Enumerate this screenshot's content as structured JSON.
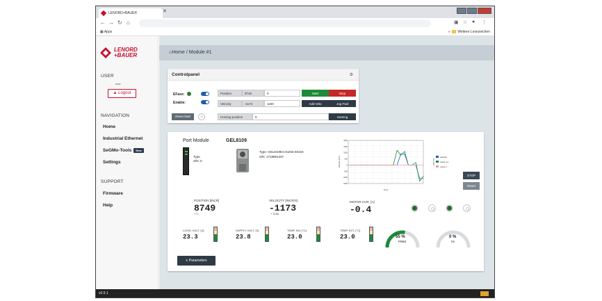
{
  "browser": {
    "tab_title": "LENORD+BAUER",
    "apps_label": "Apps",
    "bookmark_folder": "Weitere Lesezeichen"
  },
  "logo": {
    "line1": "LENORD",
    "line2": "+BAUER",
    "brand_color": "#c8102e"
  },
  "sidebar": {
    "user_title": "USER",
    "user_name": "user",
    "logout_label": "Logout",
    "navigation_title": "NAVIGATION",
    "nav_items": [
      "Home",
      "Industrial Ethernet",
      "SeGMo-Tools",
      "Settings"
    ],
    "new_badge": "New",
    "support_title": "SUPPORT",
    "support_items": [
      "Firmware",
      "Help"
    ]
  },
  "breadcrumb": {
    "home": "Home",
    "separator": "/",
    "current": "Module #1"
  },
  "controlpanel": {
    "title": "Controlpanel",
    "efase_label": "EFase:",
    "enable_label": "Enable:",
    "position_label": "Position",
    "position_value": "8749",
    "position_input": "0",
    "start_label": "Start",
    "stop_label": "Stop",
    "velocity_label": "Velocity",
    "velocity_value": "-1173",
    "velocity_input": "1150",
    "add_velocity_label": "Add Velo",
    "jog_label": "Jog Fwd",
    "reset_fault_label": "Reset fault",
    "homing_label": "Homing position",
    "homing_value": "0",
    "homing_button": "Homing"
  },
  "module": {
    "title": "Port Module",
    "device_name": "GEL8109",
    "device_type_label": "Type",
    "device_sn_label": "S/N: 0",
    "sensor_type": "Type: GEL8109CCS1N5-S0103",
    "sensor_sn": "S/N: 1718891337",
    "stop_label": "STOP",
    "reset_label": "Reset",
    "params_label": "Parameters",
    "measurements": [
      {
        "label": "POSITION [INCR]",
        "value": "8749",
        "sub": "+ 0"
      },
      {
        "label": "VELOCITY [INCR/S]",
        "value": "-1173",
        "sub": "+ 1155"
      },
      {
        "label": "MOTOR CUR. [A]",
        "value": "-0.4",
        "sub": ""
      }
    ],
    "small_measures": [
      {
        "label": "LOGIC VOLT. [V]",
        "value": "23.3",
        "level": 0.7
      },
      {
        "label": "SUPPLY VOLT. [V]",
        "value": "23.8",
        "level": 0.7
      },
      {
        "label": "TEMP. INV. [°C]",
        "value": "23.0",
        "level": 0.5
      },
      {
        "label": "TEMP. EXT. [°C]",
        "value": "23.0",
        "level": 0.5
      }
    ],
    "gauges": [
      {
        "value": "55 %",
        "label": "PWM",
        "fraction": 0.55,
        "color": "#1d8a3a"
      },
      {
        "value": "0 %",
        "label": "I%",
        "fraction": 0.0,
        "color": "#1d8a3a"
      }
    ]
  },
  "chart_data": {
    "type": "line",
    "legend": [
      "velocity",
      "motor cur",
      "motor_I"
    ],
    "colors": [
      "#1a5fb4",
      "#1d8a3a",
      "#e79bb2"
    ],
    "ylabel_left": "Velocity [n/s]",
    "ylabel_right": "Current",
    "xlabel": "Time",
    "series": [
      {
        "name": "velocity",
        "values": [
          0,
          0,
          0,
          0,
          0,
          0,
          0,
          0,
          0,
          0,
          0,
          0,
          0,
          0,
          900,
          900,
          0,
          0,
          0,
          -1100,
          -1100
        ]
      },
      {
        "name": "motor cur",
        "values": [
          0,
          0,
          0,
          0,
          0,
          0,
          0,
          0,
          0,
          0,
          0,
          0,
          0,
          1200,
          800,
          1100,
          0,
          0,
          200,
          -1300,
          -900
        ]
      },
      {
        "name": "motor_I",
        "values": [
          0,
          0,
          0,
          0,
          0,
          0,
          0,
          0,
          0,
          0,
          0,
          0,
          0,
          0,
          0,
          0,
          0,
          0,
          0,
          0,
          0
        ]
      }
    ],
    "ylim": [
      -1500,
      2000
    ]
  },
  "statusbar": {
    "version": "v0.9.1"
  }
}
